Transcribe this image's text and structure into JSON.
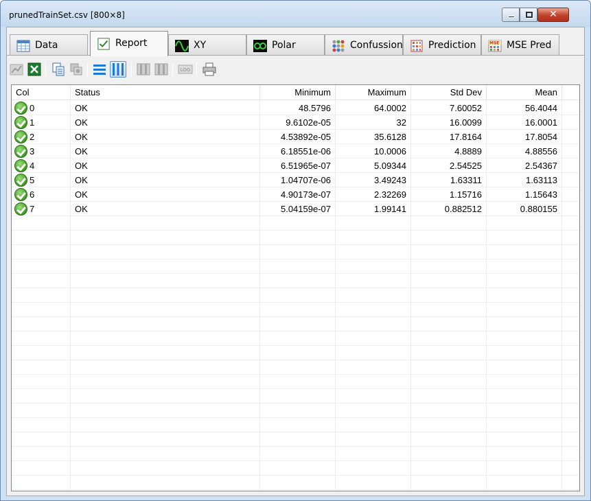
{
  "window": {
    "title": "prunedTrainSet.csv [800×8]"
  },
  "tabs": [
    {
      "label": "Data",
      "icon": "table-icon",
      "active": false
    },
    {
      "label": "Report",
      "icon": "checkmark-icon",
      "active": true
    },
    {
      "label": "XY",
      "icon": "sine-wave-icon",
      "active": false
    },
    {
      "label": "Polar",
      "icon": "polar-icon",
      "active": false
    },
    {
      "label": "Confussion",
      "icon": "confusion-matrix-icon",
      "active": false
    },
    {
      "label": "Prediction",
      "icon": "prediction-grid-icon",
      "active": false
    },
    {
      "label": "MSE Pred",
      "icon": "mse-icon",
      "active": false
    }
  ],
  "toolbar": {
    "buttons": [
      "chart-icon",
      "excel-icon",
      "copy-icon",
      "copy-image-icon",
      "rows-view-icon",
      "columns-view-icon",
      "column-left-icon",
      "column-right-icon",
      "log-icon",
      "print-icon"
    ],
    "log_label": "LOG"
  },
  "table": {
    "columns": [
      "Col",
      "Status",
      "Minimum",
      "Maximum",
      "Std Dev",
      "Mean"
    ],
    "rows": [
      {
        "col": "0",
        "status": "OK",
        "min": "48.5796",
        "max": "64.0002",
        "std": "7.60052",
        "mean": "56.4044"
      },
      {
        "col": "1",
        "status": "OK",
        "min": "9.6102e-05",
        "max": "32",
        "std": "16.0099",
        "mean": "16.0001"
      },
      {
        "col": "2",
        "status": "OK",
        "min": "4.53892e-05",
        "max": "35.6128",
        "std": "17.8164",
        "mean": "17.8054"
      },
      {
        "col": "3",
        "status": "OK",
        "min": "6.18551e-06",
        "max": "10.0006",
        "std": "4.8889",
        "mean": "4.88556"
      },
      {
        "col": "4",
        "status": "OK",
        "min": "6.51965e-07",
        "max": "5.09344",
        "std": "2.54525",
        "mean": "2.54367"
      },
      {
        "col": "5",
        "status": "OK",
        "min": "1.04707e-06",
        "max": "3.49243",
        "std": "1.63311",
        "mean": "1.63113"
      },
      {
        "col": "6",
        "status": "OK",
        "min": "4.90173e-07",
        "max": "2.32269",
        "std": "1.15716",
        "mean": "1.15643"
      },
      {
        "col": "7",
        "status": "OK",
        "min": "5.04159e-07",
        "max": "1.99141",
        "std": "0.882512",
        "mean": "0.880155"
      }
    ]
  },
  "colors": {
    "ok_green": "#3f9a22",
    "title_bar": "#c4d8ee",
    "close_red": "#c2412a"
  }
}
